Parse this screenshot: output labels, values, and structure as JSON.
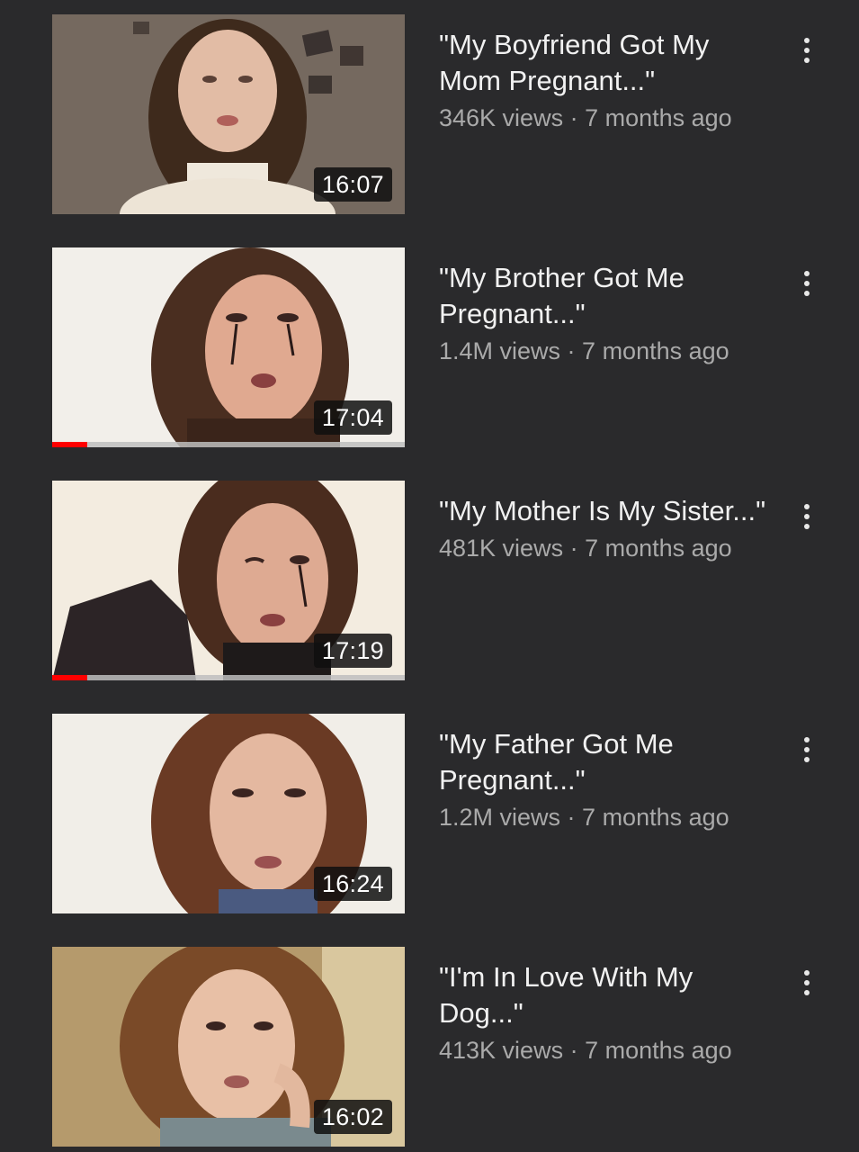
{
  "videos": [
    {
      "title": "\"My Boyfriend Got My Mom Pregnant...\"",
      "views": "346K views",
      "age": "7 months ago",
      "duration": "16:07",
      "watched": 0,
      "more_icon": "more-vert-icon"
    },
    {
      "title": "\"My Brother Got Me Pregnant...\"",
      "views": "1.4M views",
      "age": "7 months ago",
      "duration": "17:04",
      "watched": 0.1,
      "more_icon": "more-vert-icon"
    },
    {
      "title": "\"My Mother Is My Sister...\"",
      "views": "481K views",
      "age": "7 months ago",
      "duration": "17:19",
      "watched": 0.1,
      "more_icon": "more-vert-icon"
    },
    {
      "title": "\"My Father Got Me Pregnant...\"",
      "views": "1.2M views",
      "age": "7 months ago",
      "duration": "16:24",
      "watched": 0,
      "more_icon": "more-vert-icon"
    },
    {
      "title": "\"I'm In Love With My Dog...\"",
      "views": "413K views",
      "age": "7 months ago",
      "duration": "16:02",
      "watched": 0,
      "more_icon": "more-vert-icon"
    }
  ],
  "separator": " · ",
  "colors": {
    "background": "#2a2a2c",
    "progress": "#ff0000",
    "title": "#f1f1f1",
    "subtext": "#aaaaaa"
  }
}
